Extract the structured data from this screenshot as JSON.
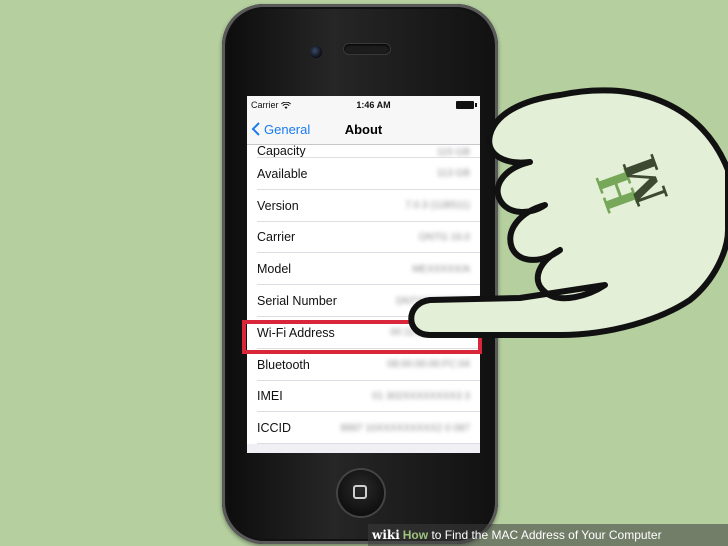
{
  "status_bar": {
    "carrier": "Carrier",
    "time": "1:46 AM"
  },
  "nav": {
    "back_label": "General",
    "title": "About"
  },
  "rows": [
    {
      "label": "Capacity",
      "value": "115 GB"
    },
    {
      "label": "Available",
      "value": "113 GB"
    },
    {
      "label": "Version",
      "value": "7.0.3 (11B511)"
    },
    {
      "label": "Carrier",
      "value": "ONTG 16.0"
    },
    {
      "label": "Model",
      "value": "MEXXXXX/A"
    },
    {
      "label": "Serial Number",
      "value": "DNTXXXXXXXX"
    },
    {
      "label": "Wi-Fi Address",
      "value": "00:11:22:33:44:55"
    },
    {
      "label": "Bluetooth",
      "value": "08:00:00:00:FC:04"
    },
    {
      "label": "IMEI",
      "value": "01 302XXXXXXXX3 3"
    },
    {
      "label": "ICCID",
      "value": "8997 10XXXXXXXXX2 0 087"
    }
  ],
  "highlighted_row": "Wi-Fi Address",
  "footer": {
    "wiki": "wiki",
    "how": "How",
    "caption": " to Find the MAC Address of Your Computer"
  },
  "colors": {
    "background": "#b5cf9f",
    "highlight": "#d8263b",
    "ios_blue": "#1a7bf2",
    "hand_fill": "#e3efd6"
  }
}
